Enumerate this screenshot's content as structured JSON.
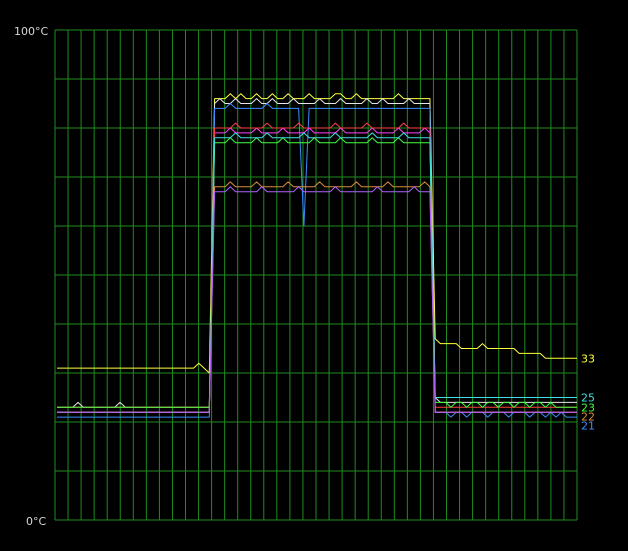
{
  "chart_data": {
    "type": "line",
    "title": "",
    "xlabel": "",
    "ylabel": "",
    "ylim": [
      0,
      100
    ],
    "y_tick_labels": {
      "max": "100°C",
      "min": "0°C"
    },
    "grid": true,
    "grid_color": "#1f8c1f",
    "background": "#000000",
    "x_samples": 100,
    "series": [
      {
        "color": "#ffff3c",
        "end_label": "33",
        "values": [
          31,
          31,
          31,
          31,
          31,
          31,
          31,
          31,
          31,
          31,
          31,
          31,
          31,
          31,
          31,
          31,
          31,
          31,
          31,
          31,
          31,
          31,
          31,
          31,
          31,
          31,
          31,
          32,
          31,
          30,
          86,
          86,
          86,
          87,
          86,
          87,
          86,
          86,
          87,
          86,
          86,
          87,
          86,
          86,
          87,
          86,
          86,
          86,
          87,
          86,
          86,
          86,
          86,
          87,
          87,
          86,
          86,
          87,
          86,
          86,
          86,
          86,
          86,
          86,
          86,
          87,
          86,
          86,
          86,
          86,
          86,
          86,
          37,
          36,
          36,
          36,
          36,
          35,
          35,
          35,
          35,
          36,
          35,
          35,
          35,
          35,
          35,
          35,
          34,
          34,
          34,
          34,
          34,
          33,
          33,
          33,
          33,
          33,
          33,
          33
        ]
      },
      {
        "color": "#e6e6e6",
        "end_label": "",
        "values": [
          23,
          23,
          23,
          23,
          24,
          23,
          23,
          23,
          23,
          23,
          23,
          23,
          24,
          23,
          23,
          23,
          23,
          23,
          23,
          23,
          23,
          23,
          23,
          23,
          23,
          23,
          23,
          23,
          23,
          23,
          85,
          86,
          85,
          85,
          86,
          85,
          85,
          85,
          86,
          85,
          85,
          86,
          85,
          85,
          85,
          86,
          85,
          85,
          85,
          85,
          86,
          85,
          85,
          85,
          86,
          85,
          85,
          85,
          85,
          86,
          85,
          85,
          86,
          85,
          85,
          85,
          85,
          86,
          85,
          85,
          85,
          85,
          25,
          24,
          24,
          24,
          24,
          24,
          24,
          24,
          24,
          24,
          24,
          24,
          24,
          24,
          24,
          24,
          24,
          24,
          24,
          24,
          24,
          24,
          24,
          24,
          24,
          24,
          24,
          24
        ]
      },
      {
        "color": "#3a8cff",
        "end_label": "21",
        "values": [
          21,
          21,
          21,
          21,
          21,
          21,
          21,
          21,
          21,
          21,
          21,
          21,
          21,
          21,
          21,
          21,
          21,
          21,
          21,
          21,
          21,
          21,
          21,
          21,
          21,
          21,
          21,
          21,
          21,
          21,
          84,
          84,
          84,
          85,
          84,
          84,
          84,
          84,
          84,
          84,
          85,
          84,
          84,
          84,
          84,
          84,
          84,
          60,
          84,
          84,
          84,
          84,
          84,
          84,
          84,
          84,
          84,
          84,
          84,
          84,
          84,
          84,
          84,
          84,
          84,
          84,
          84,
          84,
          84,
          84,
          84,
          84,
          22,
          22,
          22,
          21,
          22,
          22,
          21,
          22,
          22,
          22,
          21,
          22,
          22,
          22,
          21,
          22,
          22,
          22,
          21,
          22,
          22,
          21,
          22,
          21,
          22,
          21,
          21,
          21
        ]
      },
      {
        "color": "#ff3cff",
        "end_label": "",
        "values": [
          22,
          22,
          22,
          22,
          22,
          22,
          22,
          22,
          22,
          22,
          22,
          22,
          22,
          22,
          22,
          22,
          22,
          22,
          22,
          22,
          22,
          22,
          22,
          22,
          22,
          22,
          22,
          22,
          22,
          22,
          79,
          79,
          79,
          80,
          79,
          79,
          79,
          79,
          80,
          79,
          79,
          79,
          79,
          80,
          79,
          79,
          79,
          79,
          80,
          79,
          79,
          79,
          79,
          79,
          80,
          79,
          79,
          79,
          79,
          79,
          80,
          79,
          79,
          79,
          79,
          80,
          79,
          79,
          79,
          79,
          80,
          79,
          22,
          22,
          22,
          22,
          22,
          22,
          22,
          22,
          22,
          22,
          22,
          22,
          22,
          22,
          22,
          22,
          22,
          22,
          22,
          22,
          22,
          22,
          22,
          22,
          22,
          22,
          22,
          22
        ]
      },
      {
        "color": "#ff4040",
        "end_label": "",
        "values": [
          23,
          23,
          23,
          23,
          23,
          23,
          23,
          23,
          23,
          23,
          23,
          23,
          23,
          23,
          23,
          23,
          23,
          23,
          23,
          23,
          23,
          23,
          23,
          23,
          23,
          23,
          23,
          23,
          23,
          23,
          80,
          80,
          80,
          80,
          81,
          80,
          80,
          80,
          80,
          80,
          81,
          80,
          80,
          80,
          80,
          80,
          81,
          80,
          80,
          80,
          80,
          80,
          80,
          81,
          80,
          80,
          80,
          80,
          80,
          81,
          80,
          80,
          80,
          80,
          80,
          80,
          81,
          80,
          80,
          80,
          80,
          80,
          23,
          23,
          23,
          23,
          23,
          23,
          23,
          23,
          23,
          23,
          23,
          23,
          23,
          23,
          23,
          23,
          23,
          23,
          23,
          23,
          23,
          23,
          23,
          23,
          23,
          23,
          23,
          23
        ]
      },
      {
        "color": "#40ff40",
        "end_label": "23",
        "values": [
          23,
          23,
          23,
          23,
          23,
          23,
          23,
          23,
          23,
          23,
          23,
          23,
          23,
          23,
          23,
          23,
          23,
          23,
          23,
          23,
          23,
          23,
          23,
          23,
          23,
          23,
          23,
          23,
          23,
          23,
          77,
          77,
          77,
          78,
          77,
          77,
          77,
          77,
          78,
          77,
          77,
          77,
          77,
          78,
          77,
          77,
          77,
          77,
          77,
          78,
          77,
          77,
          77,
          77,
          78,
          77,
          77,
          77,
          77,
          77,
          78,
          77,
          77,
          77,
          77,
          78,
          77,
          77,
          77,
          77,
          77,
          77,
          24,
          24,
          24,
          23,
          24,
          24,
          23,
          24,
          24,
          23,
          24,
          24,
          23,
          24,
          24,
          23,
          24,
          24,
          23,
          24,
          24,
          23,
          24,
          23,
          23,
          23,
          23,
          23
        ]
      },
      {
        "color": "#40e0e0",
        "end_label": "25",
        "values": [
          22,
          22,
          22,
          22,
          22,
          22,
          22,
          22,
          22,
          22,
          22,
          22,
          22,
          22,
          22,
          22,
          22,
          22,
          22,
          22,
          22,
          22,
          22,
          22,
          22,
          22,
          22,
          22,
          22,
          22,
          78,
          78,
          78,
          78,
          79,
          78,
          78,
          78,
          78,
          78,
          79,
          78,
          78,
          78,
          78,
          78,
          78,
          79,
          78,
          78,
          78,
          78,
          78,
          79,
          78,
          78,
          78,
          78,
          78,
          78,
          79,
          78,
          78,
          78,
          78,
          78,
          79,
          78,
          78,
          78,
          78,
          78,
          25,
          25,
          25,
          25,
          25,
          25,
          25,
          25,
          25,
          25,
          25,
          25,
          25,
          25,
          25,
          25,
          25,
          25,
          25,
          25,
          25,
          25,
          25,
          25,
          25,
          25,
          25,
          25
        ]
      },
      {
        "color": "#d98c3a",
        "end_label": "22",
        "values": [
          22,
          22,
          22,
          22,
          22,
          22,
          22,
          22,
          22,
          22,
          22,
          22,
          22,
          22,
          22,
          22,
          22,
          22,
          22,
          22,
          22,
          22,
          22,
          22,
          22,
          22,
          22,
          22,
          22,
          22,
          68,
          68,
          68,
          69,
          68,
          68,
          68,
          68,
          69,
          68,
          68,
          68,
          68,
          68,
          69,
          68,
          68,
          68,
          68,
          68,
          69,
          68,
          68,
          68,
          68,
          68,
          68,
          69,
          68,
          68,
          68,
          68,
          68,
          69,
          68,
          68,
          68,
          68,
          68,
          68,
          69,
          68,
          22,
          22,
          22,
          22,
          22,
          22,
          22,
          22,
          22,
          22,
          22,
          22,
          22,
          22,
          22,
          22,
          22,
          22,
          22,
          22,
          22,
          22,
          22,
          22,
          22,
          22,
          22,
          22
        ]
      },
      {
        "color": "#b060ff",
        "end_label": "",
        "values": [
          22,
          22,
          22,
          22,
          22,
          22,
          22,
          22,
          22,
          22,
          22,
          22,
          22,
          22,
          22,
          22,
          22,
          22,
          22,
          22,
          22,
          22,
          22,
          22,
          22,
          22,
          22,
          22,
          22,
          22,
          67,
          67,
          67,
          68,
          67,
          67,
          67,
          67,
          67,
          68,
          67,
          67,
          67,
          67,
          67,
          67,
          68,
          67,
          67,
          67,
          67,
          67,
          67,
          68,
          67,
          67,
          67,
          67,
          67,
          67,
          67,
          68,
          67,
          67,
          67,
          67,
          67,
          67,
          68,
          67,
          67,
          67,
          22,
          22,
          22,
          22,
          22,
          22,
          22,
          22,
          22,
          22,
          22,
          22,
          22,
          22,
          22,
          22,
          22,
          22,
          22,
          22,
          22,
          22,
          22,
          22,
          22,
          22,
          22,
          22
        ]
      }
    ]
  }
}
